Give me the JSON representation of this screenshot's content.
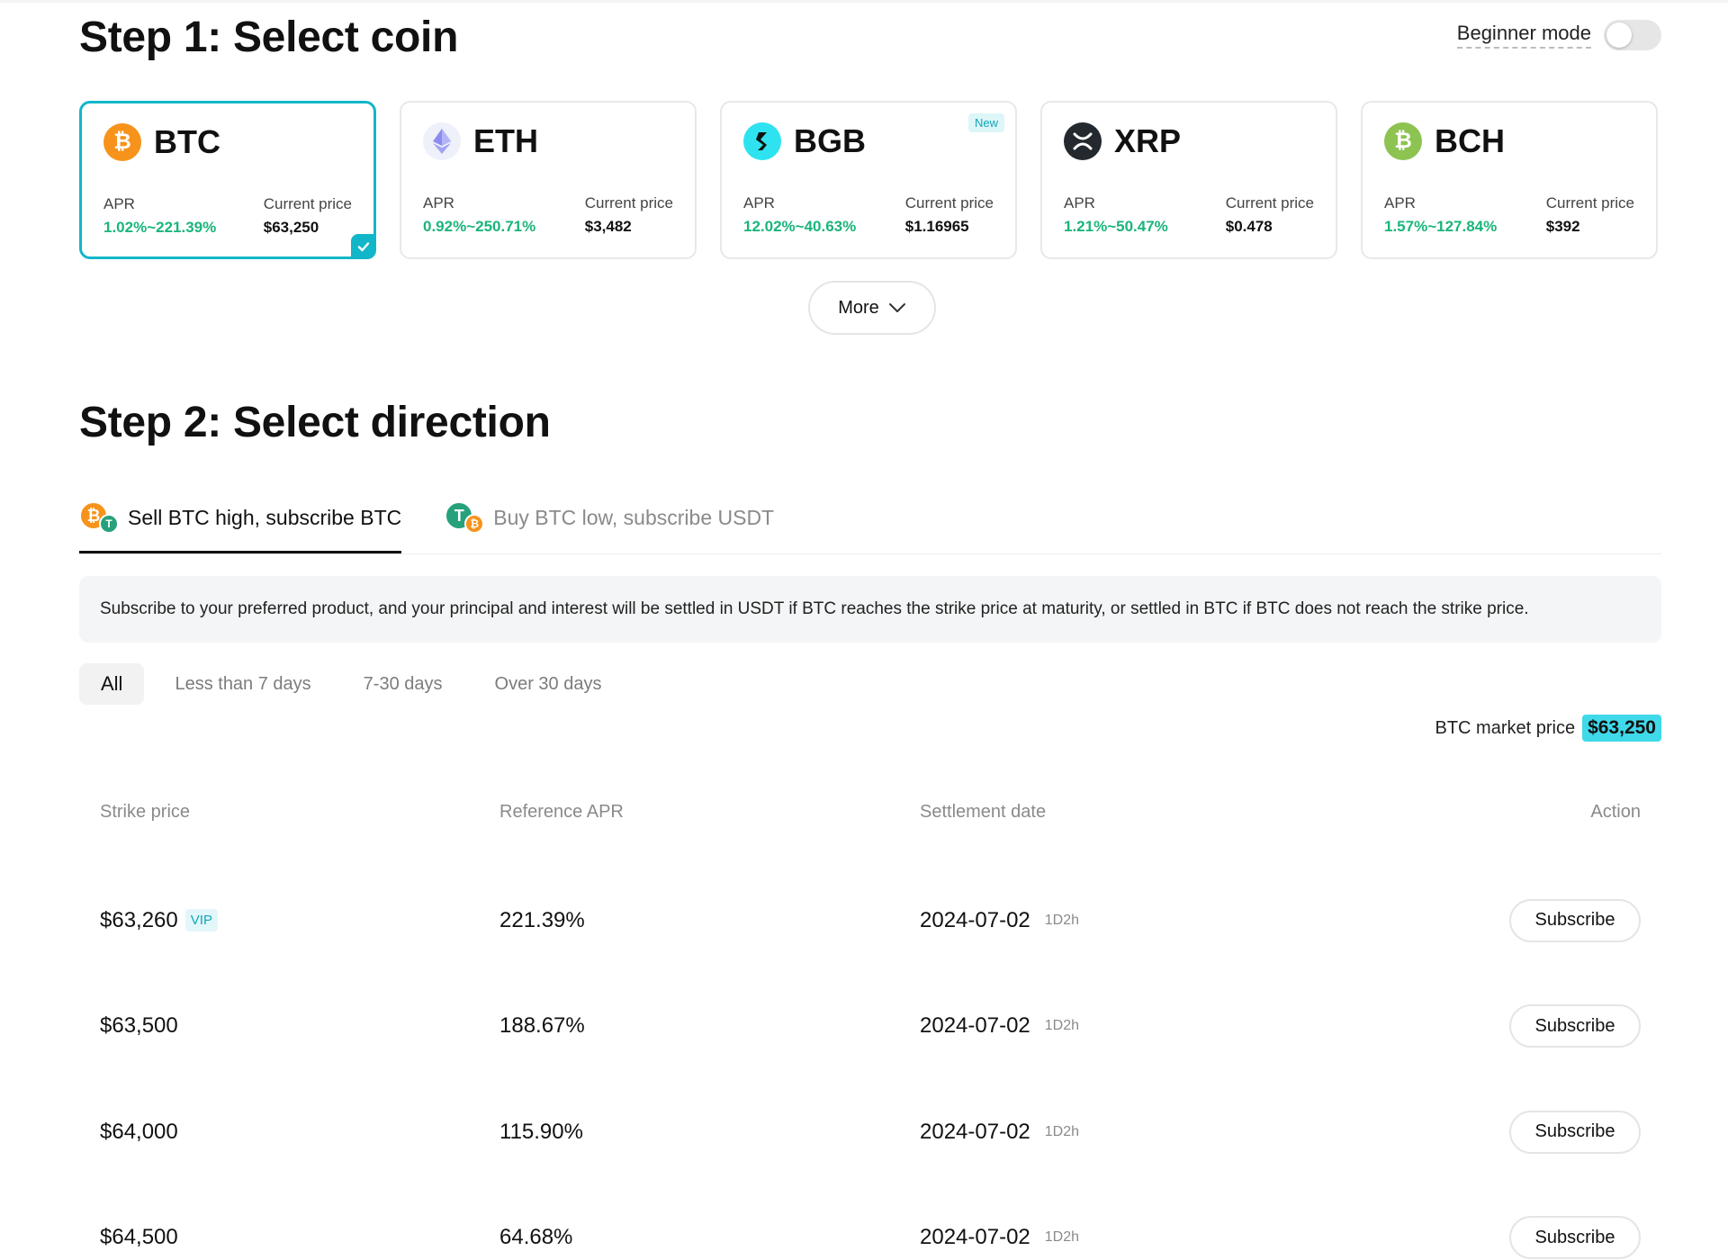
{
  "step1": {
    "title": "Step 1: Select coin"
  },
  "beginner_mode": {
    "label": "Beginner mode",
    "enabled": false
  },
  "coins": [
    {
      "name": "BTC",
      "apr_label": "APR",
      "apr": "1.02%~221.39%",
      "price_label": "Current price",
      "price": "$63,250",
      "selected": true,
      "icon": "bitcoin-icon",
      "color": "#f7931a",
      "glyph": "₿"
    },
    {
      "name": "ETH",
      "apr_label": "APR",
      "apr": "0.92%~250.71%",
      "price_label": "Current price",
      "price": "$3,482",
      "selected": false,
      "icon": "ethereum-icon",
      "color": "#eef0fa"
    },
    {
      "name": "BGB",
      "apr_label": "APR",
      "apr": "12.02%~40.63%",
      "price_label": "Current price",
      "price": "$1.16965",
      "selected": false,
      "icon": "bitget-icon",
      "color": "#2ee3ef",
      "badge": "New"
    },
    {
      "name": "XRP",
      "apr_label": "APR",
      "apr": "1.21%~50.47%",
      "price_label": "Current price",
      "price": "$0.478",
      "selected": false,
      "icon": "xrp-icon",
      "color": "#23292f"
    },
    {
      "name": "BCH",
      "apr_label": "APR",
      "apr": "1.57%~127.84%",
      "price_label": "Current price",
      "price": "$392",
      "selected": false,
      "icon": "bitcoin-cash-icon",
      "color": "#8dc351",
      "glyph": "₿"
    }
  ],
  "more_button": {
    "label": "More"
  },
  "step2": {
    "title": "Step 2: Select direction"
  },
  "direction_tabs": [
    {
      "label": "Sell BTC high, subscribe BTC",
      "active": true
    },
    {
      "label": "Buy BTC low, subscribe USDT",
      "active": false
    }
  ],
  "info_text": "Subscribe to your preferred product, and your principal and interest will be settled in USDT if BTC reaches the strike price at maturity, or settled in BTC if BTC does not reach the strike price.",
  "duration_filters": [
    {
      "label": "All",
      "active": true
    },
    {
      "label": "Less than 7 days",
      "active": false
    },
    {
      "label": "7-30 days",
      "active": false
    },
    {
      "label": "Over 30 days",
      "active": false
    }
  ],
  "market_price": {
    "label": "BTC market price",
    "value": "$63,250"
  },
  "table": {
    "headers": {
      "strike": "Strike price",
      "apr": "Reference APR",
      "settlement": "Settlement date",
      "action": "Action"
    },
    "rows": [
      {
        "strike": "$63,260",
        "vip": "VIP",
        "apr": "221.39%",
        "date": "2024-07-02",
        "duration": "1D2h",
        "action": "Subscribe"
      },
      {
        "strike": "$63,500",
        "apr": "188.67%",
        "date": "2024-07-02",
        "duration": "1D2h",
        "action": "Subscribe"
      },
      {
        "strike": "$64,000",
        "apr": "115.90%",
        "date": "2024-07-02",
        "duration": "1D2h",
        "action": "Subscribe"
      },
      {
        "strike": "$64,500",
        "apr": "64.68%",
        "date": "2024-07-02",
        "duration": "1D2h",
        "action": "Subscribe"
      }
    ]
  },
  "colors": {
    "accent": "#12b6c9",
    "apr_green": "#1ab57a",
    "price_highlight": "#3fd9ea"
  }
}
